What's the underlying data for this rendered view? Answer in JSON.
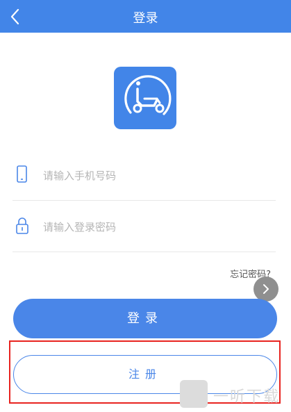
{
  "header": {
    "title": "登录",
    "back_icon": "chevron-left-icon"
  },
  "logo": {
    "icon": "scooter-gauge-icon",
    "color": "#4285e8"
  },
  "phone_field": {
    "placeholder": "请输入手机号码",
    "icon": "phone-icon"
  },
  "password_field": {
    "placeholder": "请输入登录密码",
    "icon": "lock-icon"
  },
  "forgot_password": "忘记密码?",
  "login_button": "登录",
  "register_button": "注册",
  "watermark": {
    "text": "一听下载"
  },
  "colors": {
    "primary": "#4285e8",
    "highlight": "#e8231f"
  }
}
